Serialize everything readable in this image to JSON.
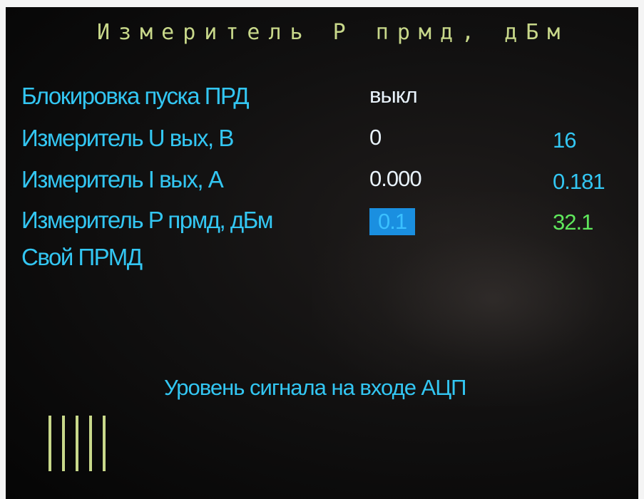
{
  "title": "Измеритель P прмд, дБм",
  "rows": [
    {
      "label": "Блокировка пуска ПРД",
      "value1": "выкл",
      "value2": ""
    },
    {
      "label": "Измеритель U вых, В",
      "value1": "0",
      "value2": "16"
    },
    {
      "label": "Измеритель I вых, А",
      "value1": "0.000",
      "value2": "0.181"
    },
    {
      "label": "Измеритель P прмд, дБм",
      "value1": "0.1",
      "value2": "32.1"
    },
    {
      "label": "Свой ПРМД",
      "value1": "",
      "value2": ""
    }
  ],
  "selected_row": 3,
  "bottom_label": "Уровень сигнала на входе АЦП",
  "signal_level_bars": 5,
  "colors": {
    "title": "#c8d88a",
    "label": "#33c6f2",
    "value": "#e8f2fb",
    "highlight_bg": "#1a8fe0",
    "value_green": "#5fe85c",
    "bars": "#c8d88a"
  }
}
